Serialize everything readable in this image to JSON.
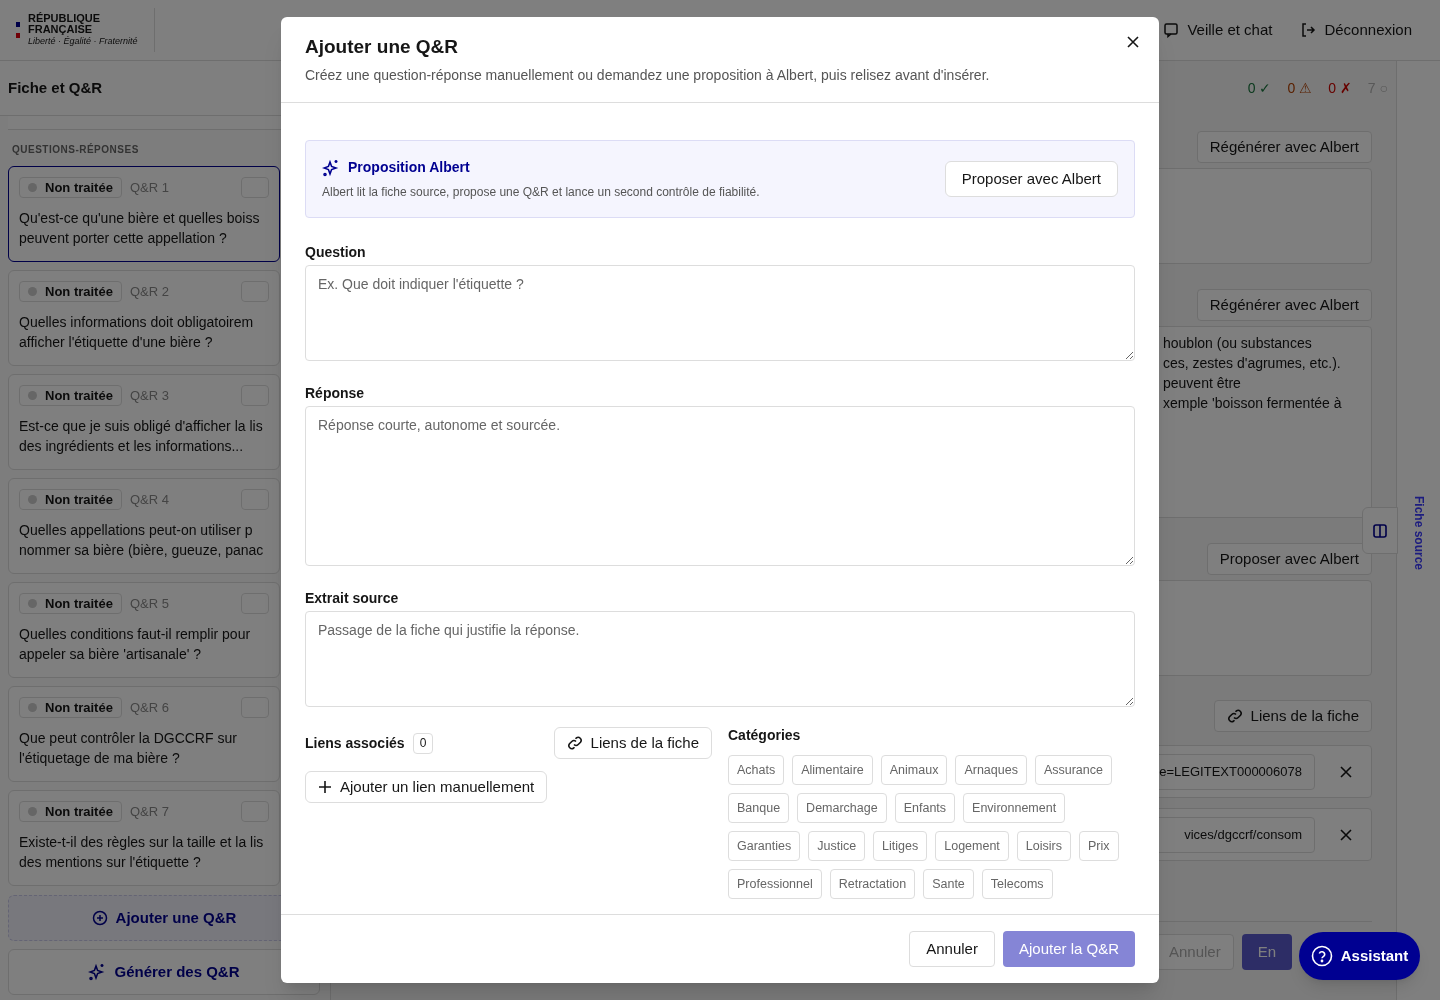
{
  "header": {
    "logo_lines": [
      "RÉPUBLIQUE",
      "FRANÇAISE"
    ],
    "motto": "Liberté · Égalité · Fraternité",
    "nav": [
      {
        "label": "Veille et chat"
      },
      {
        "label": "Déconnexion"
      }
    ]
  },
  "sidebar": {
    "title": "Fiche et Q&R",
    "section": "QUESTIONS-RÉPONSES",
    "items": [
      {
        "status": "Non traitée",
        "label": "Q&R 1",
        "lines": [
          "Qu'est-ce qu'une bière et quelles boiss",
          "peuvent porter cette appellation ?"
        ],
        "selected": true
      },
      {
        "status": "Non traitée",
        "label": "Q&R 2",
        "lines": [
          "Quelles informations doit obligatoirem",
          "afficher l'étiquette d'une bière ?"
        ],
        "selected": false
      },
      {
        "status": "Non traitée",
        "label": "Q&R 3",
        "lines": [
          "Est-ce que je suis obligé d'afficher la lis",
          "des ingrédients et les informations..."
        ],
        "selected": false
      },
      {
        "status": "Non traitée",
        "label": "Q&R 4",
        "lines": [
          "Quelles appellations peut-on utiliser p",
          "nommer sa bière (bière, gueuze, panac"
        ],
        "selected": false
      },
      {
        "status": "Non traitée",
        "label": "Q&R 5",
        "lines": [
          "Quelles conditions faut-il remplir pour",
          "appeler sa bière 'artisanale' ?"
        ],
        "selected": false
      },
      {
        "status": "Non traitée",
        "label": "Q&R 6",
        "lines": [
          "Que peut contrôler la DGCCRF sur",
          "l'étiquetage de ma bière ?"
        ],
        "selected": false
      },
      {
        "status": "Non traitée",
        "label": "Q&R 7",
        "lines": [
          "Existe-t-il des règles sur la taille et la lis",
          "des mentions sur l'étiquette ?"
        ],
        "selected": false
      }
    ],
    "buttons": [
      {
        "label": "Ajouter une Q&R",
        "kind": "add"
      },
      {
        "label": "Générer des Q&R",
        "kind": "generate"
      }
    ]
  },
  "counters": [
    {
      "value": "0",
      "symbol": "✓",
      "kind": "valid"
    },
    {
      "value": "0",
      "symbol": "⚠",
      "kind": "warning"
    },
    {
      "value": "0",
      "symbol": "✗",
      "kind": "error"
    },
    {
      "value": "7",
      "symbol": "○",
      "kind": "pending"
    }
  ],
  "editor": {
    "regenerate_buttons": [
      "Régénérer avec Albert",
      "Régénérer avec Albert"
    ],
    "answer_lines": [
      "houblon (ou substances",
      "ces, zestes d'agrumes, etc.).",
      "peuvent être",
      "xemple 'boisson fermentée à"
    ],
    "propose_button": "Proposer avec Albert",
    "links_button": "Liens de la fiche",
    "links": [
      "e=LEGITEXT000006078",
      "vices/dgccrf/consom"
    ],
    "cancel": "Annuler",
    "submit": "En"
  },
  "side_panel": {
    "label": "Fiche source"
  },
  "assistant": {
    "label": "Assistant"
  },
  "modal": {
    "title": "Ajouter une Q&R",
    "subtitle": "Créez une question-réponse manuellement ou demandez une proposition à Albert, puis relisez avant d'insérer.",
    "albert": {
      "title": "Proposition Albert",
      "description": "Albert lit la fiche source, propose une Q&R et lance un second contrôle de fiabilité.",
      "button": "Proposer avec Albert"
    },
    "fields": [
      {
        "label": "Question",
        "placeholder": "Ex. Que doit indiquer l'étiquette ?"
      },
      {
        "label": "Réponse",
        "placeholder": "Réponse courte, autonome et sourcée."
      },
      {
        "label": "Extrait source",
        "placeholder": "Passage de la fiche qui justifie la réponse."
      }
    ],
    "links": {
      "label": "Liens associés",
      "count": "0",
      "fiche_button": "Liens de la fiche",
      "add_button": "Ajouter un lien manuellement"
    },
    "categories": {
      "label": "Catégories",
      "items": [
        {
          "label": "Achats",
          "selected": false
        },
        {
          "label": "Alimentaire",
          "selected": false
        },
        {
          "label": "Animaux",
          "selected": false
        },
        {
          "label": "Arnaques",
          "selected": false
        },
        {
          "label": "Assurance",
          "selected": false
        },
        {
          "label": "Banque",
          "selected": false
        },
        {
          "label": "Demarchage",
          "selected": false
        },
        {
          "label": "Enfants",
          "selected": false
        },
        {
          "label": "Environnement",
          "selected": false
        },
        {
          "label": "Garanties",
          "selected": false
        },
        {
          "label": "Justice",
          "selected": false
        },
        {
          "label": "Litiges",
          "selected": false
        },
        {
          "label": "Logement",
          "selected": false
        },
        {
          "label": "Loisirs",
          "selected": false
        },
        {
          "label": "Prix",
          "selected": false
        },
        {
          "label": "Professionnel",
          "selected": false
        },
        {
          "label": "Retractation",
          "selected": false
        },
        {
          "label": "Sante",
          "selected": false
        },
        {
          "label": "Telecoms",
          "selected": false
        }
      ]
    },
    "actions": {
      "cancel": "Annuler",
      "submit": {
        "label": "Ajouter la Q&R",
        "disabled": true
      }
    }
  }
}
